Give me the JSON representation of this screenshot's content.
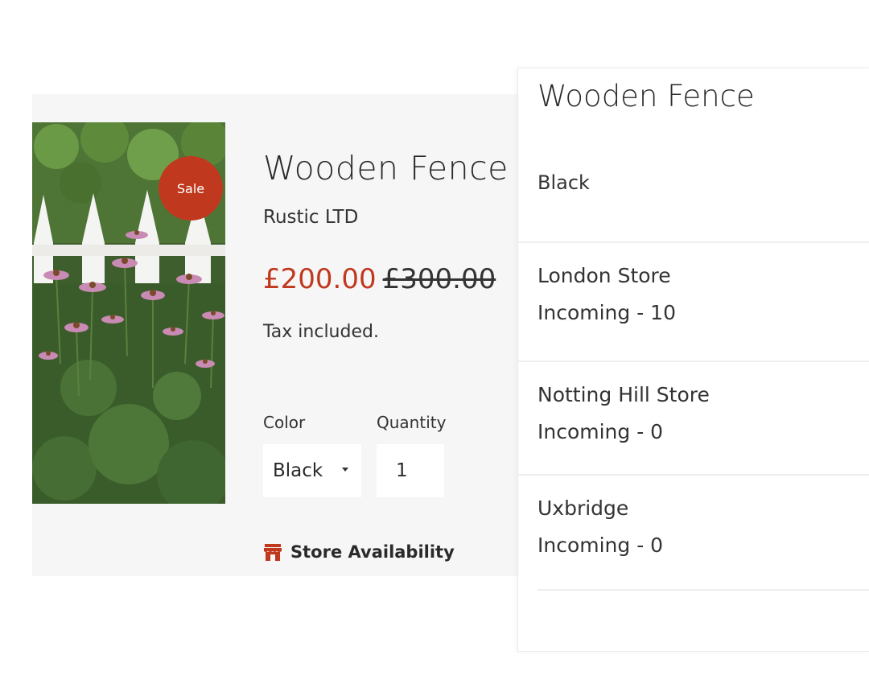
{
  "product": {
    "title": "Wooden Fence",
    "vendor": "Rustic LTD",
    "badge": "Sale",
    "price": "£200.00",
    "compare_at_price": "£300.00",
    "tax_note": "Tax included.",
    "color_label": "Color",
    "color_value": "Black",
    "quantity_label": "Quantity",
    "quantity_value": "1",
    "store_availability_label": "Store Availability",
    "image_icon": "product-photo",
    "store_icon": "store-icon"
  },
  "drawer": {
    "title": "Wooden Fence",
    "variant": "Black",
    "stores": [
      {
        "name": "London Store",
        "status": "Incoming - 10"
      },
      {
        "name": "Notting Hill Store",
        "status": "Incoming - 0"
      },
      {
        "name": "Uxbridge",
        "status": "Incoming - 0"
      }
    ]
  },
  "colors": {
    "accent": "#c0391f",
    "card_background": "#f6f6f6",
    "text": "#2a2a2a"
  }
}
